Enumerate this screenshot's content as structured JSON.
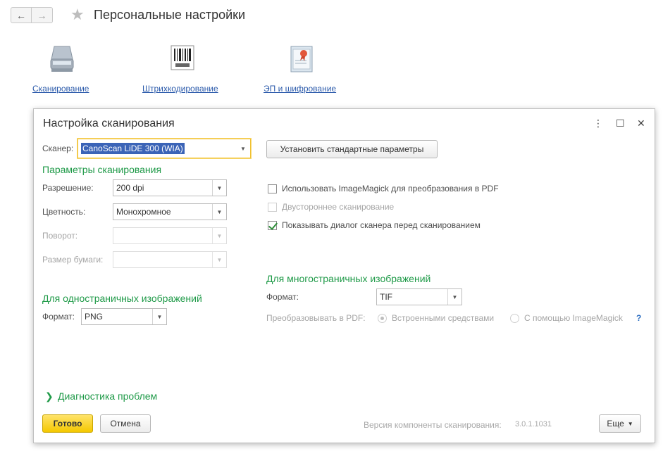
{
  "header": {
    "back_icon": "arrow-left-icon",
    "forward_icon": "arrow-right-icon",
    "favorite_icon": "star-icon",
    "title": "Персональные настройки"
  },
  "features": [
    {
      "label": "Сканирование",
      "icon": "scanner-icon"
    },
    {
      "label": "Штрихкодирование",
      "icon": "barcode-icon"
    },
    {
      "label": "ЭП и шифрование",
      "icon": "certificate-icon"
    }
  ],
  "dialog": {
    "title": "Настройка сканирования",
    "controls": {
      "more": "⋮",
      "maximize": "☐",
      "close": "✕"
    },
    "scanner": {
      "label": "Сканер:",
      "value": "CanoScan LiDE 300 (WIA)"
    },
    "reset_button": "Установить стандартные параметры",
    "scan_params": {
      "heading": "Параметры сканирования",
      "resolution": {
        "label": "Разрешение:",
        "value": "200 dpi"
      },
      "color": {
        "label": "Цветность:",
        "value": "Монохромное"
      },
      "rotation": {
        "label": "Поворот:",
        "value": ""
      },
      "paper_size": {
        "label": "Размер бумаги:",
        "value": ""
      }
    },
    "options": {
      "use_imagemagick": {
        "label": "Использовать ImageMagick для преобразования в PDF",
        "checked": false
      },
      "duplex": {
        "label": "Двустороннее сканирование",
        "checked": false,
        "disabled": true
      },
      "show_dialog": {
        "label": "Показывать диалог сканера перед сканированием",
        "checked": true
      }
    },
    "single_page": {
      "heading": "Для одностраничных изображений",
      "format_label": "Формат:",
      "format_value": "PNG"
    },
    "multi_page": {
      "heading": "Для многостраничных изображений",
      "format_label": "Формат:",
      "format_value": "TIF",
      "convert_label": "Преобразовывать в PDF:",
      "convert_builtin": "Встроенными средствами",
      "convert_imagemagick": "С помощью ImageMagick",
      "help": "?"
    },
    "diagnostics": "Диагностика проблем",
    "ok_button": "Готово",
    "cancel_button": "Отмена",
    "version_text": "Версия компоненты сканирования:",
    "version_number": "3.0.1.1031",
    "more_button": "Еще"
  }
}
